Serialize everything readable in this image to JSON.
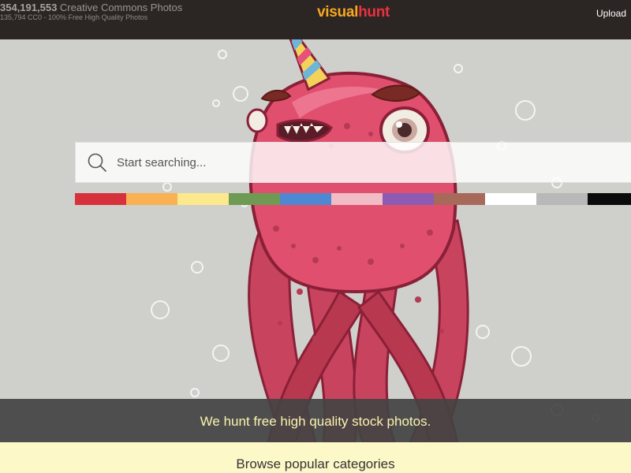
{
  "header": {
    "stats_count": "354,191,553",
    "stats_label": "Creative Commons Photos",
    "stats_sub": "135,794 CC0 - 100% Free High Quality Photos",
    "logo_part1": "visual",
    "logo_part2": "hunt",
    "upload_label": "Upload"
  },
  "search": {
    "placeholder": "Start searching...",
    "icon": "search-icon"
  },
  "color_filters": [
    {
      "name": "red",
      "color": "#d6323c"
    },
    {
      "name": "orange",
      "color": "#fab153"
    },
    {
      "name": "yellow",
      "color": "#fde98d"
    },
    {
      "name": "green",
      "color": "#6f9a54"
    },
    {
      "name": "blue",
      "color": "#4f88d2"
    },
    {
      "name": "pink",
      "color": "#f1bcc6"
    },
    {
      "name": "purple",
      "color": "#8d5bb3"
    },
    {
      "name": "brown",
      "color": "#a7695a"
    },
    {
      "name": "white",
      "color": "#ffffff"
    },
    {
      "name": "gray",
      "color": "#b8b8b8"
    },
    {
      "name": "black",
      "color": "#0b0b0b"
    }
  ],
  "banner": {
    "text": "We hunt free high quality stock photos."
  },
  "categories": {
    "title": "Browse popular categories"
  },
  "colors": {
    "topbar_bg": "#2b2523",
    "hero_bg": "#cfcfcb",
    "monster_body": "#e0506e",
    "banner_text": "#fbf3b0",
    "categories_bg": "#fdf8c8"
  }
}
